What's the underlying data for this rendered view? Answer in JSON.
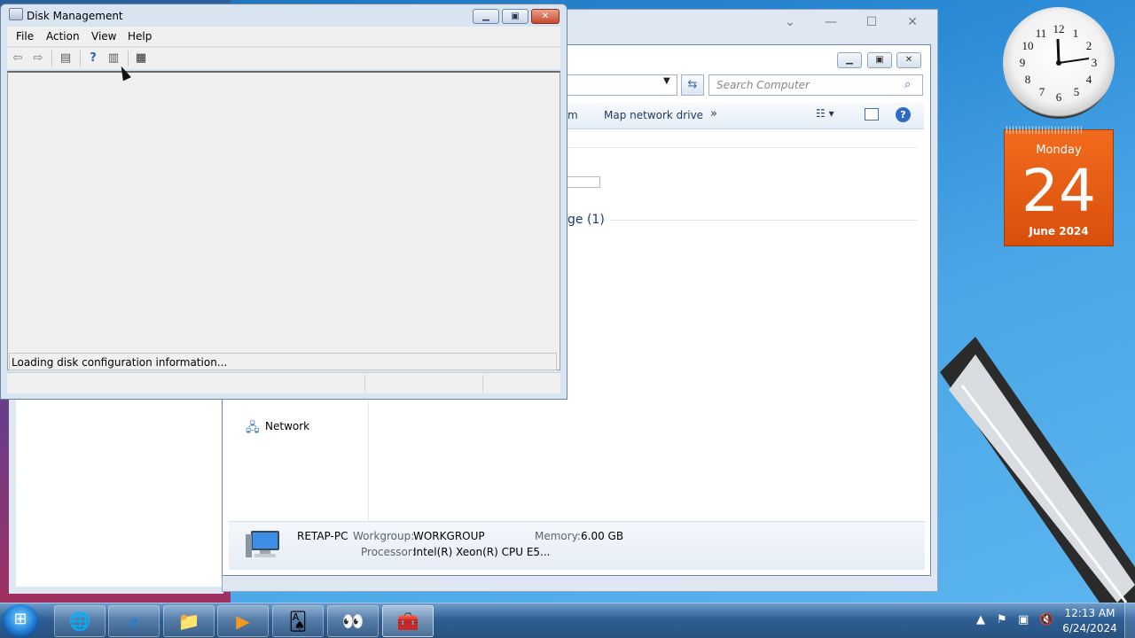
{
  "disk_management": {
    "title": "Disk Management",
    "menu": [
      "File",
      "Action",
      "View",
      "Help"
    ],
    "status": "Loading disk configuration information...",
    "controls": {
      "minimize": "minimize-icon",
      "maximize": "maximize-icon",
      "close": "close-icon"
    }
  },
  "explorer": {
    "search_placeholder": "Search Computer",
    "command_partial": "m",
    "command_map": "Map network drive",
    "command_more": "»",
    "group_header_partial": "ge (1)",
    "nav_network": "Network",
    "details": {
      "computer_name": "RETAP-PC",
      "workgroup_label": "Workgroup:",
      "workgroup_value": "WORKGROUP",
      "memory_label": "Memory:",
      "memory_value": "6.00 GB",
      "processor_label": "Processor:",
      "processor_value": "Intel(R) Xeon(R) CPU E5..."
    }
  },
  "calendar_gadget": {
    "day": "Monday",
    "date": "24",
    "month": "June 2024"
  },
  "clock_gadget": {
    "numbers": [
      "12",
      "1",
      "2",
      "3",
      "4",
      "5",
      "6",
      "7",
      "8",
      "9",
      "10",
      "11"
    ]
  },
  "taskbar": {
    "time": "12:13 AM",
    "date": "6/24/2024",
    "pinned": [
      "browser-icon",
      "internet-explorer-icon",
      "file-explorer-icon",
      "media-player-icon",
      "solitaire-icon",
      "eyes-icon",
      "toolbox-icon"
    ]
  }
}
